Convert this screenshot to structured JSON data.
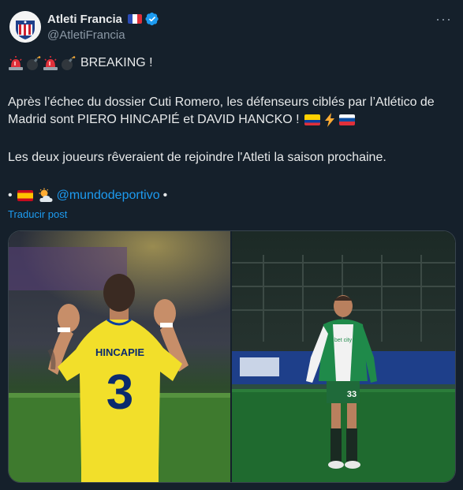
{
  "account": {
    "display_name": "Atleti Francia",
    "handle": "@AtletiFrancia"
  },
  "tweet": {
    "line1_text": "BREAKING !",
    "para2_text": "Après l’échec du dossier Cuti Romero, les défenseurs ciblés par l’Atlético de Madrid sont PIERO HINCAPIÉ et DAVID HANCKO !",
    "para3_text": "Les deux joueurs rêveraient de rejoindre l'Atleti la saison prochaine.",
    "bullet": "•",
    "mention": "@mundodeportivo",
    "bullet_end": "•",
    "translate_label": "Traducir post"
  },
  "media": {
    "left_jersey_name": "HINCAPIE",
    "left_jersey_number": "3",
    "right_shirt_number": "33",
    "right_sponsor": "bet city"
  },
  "icons": [
    "siren-icon",
    "bomb-icon",
    "siren-icon",
    "bomb-icon",
    "ecuador-flag-icon",
    "lightning-icon",
    "slovakia-flag-icon",
    "spain-flag-icon",
    "sun-behind-cloud-icon",
    "verified-badge-icon",
    "more-options-icon"
  ],
  "colors": {
    "background": "#15202b",
    "link": "#1d9bf0",
    "muted": "#8b98a5",
    "text": "#e7e9ea"
  }
}
